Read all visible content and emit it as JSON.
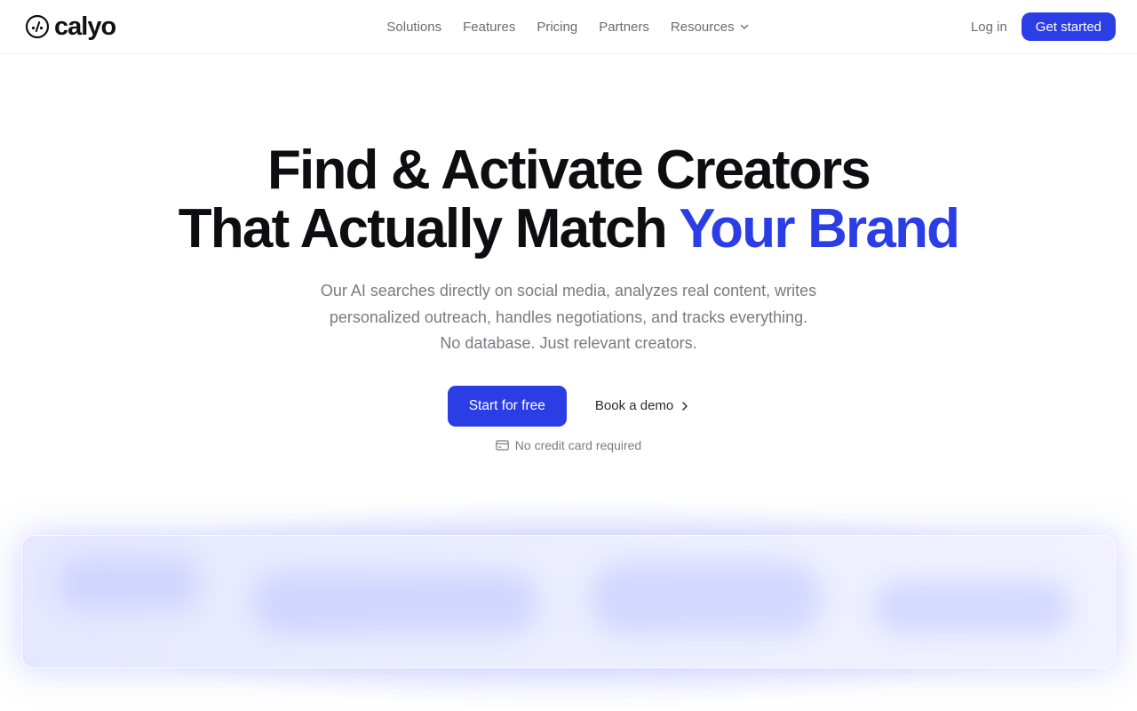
{
  "brand": {
    "name": "calyo"
  },
  "nav": {
    "items": [
      {
        "label": "Solutions"
      },
      {
        "label": "Features"
      },
      {
        "label": "Pricing"
      },
      {
        "label": "Partners"
      },
      {
        "label": "Resources",
        "has_dropdown": true
      }
    ]
  },
  "header": {
    "login_label": "Log in",
    "cta_label": "Get started"
  },
  "hero": {
    "headline_line1": "Find & Activate Creators",
    "headline_line2_prefix": "That Actually Match",
    "headline_line2_accent": "Your Brand",
    "subtext_line1": "Our AI searches directly on social media, analyzes real content, writes",
    "subtext_line2": "personalized outreach, handles negotiations, and tracks everything.",
    "subtext_line3": "No database. Just relevant creators.",
    "primary_cta": "Start for free",
    "secondary_cta": "Book a demo",
    "note": "No credit card required"
  },
  "icons": {
    "logo": "calyo-logo-icon",
    "resources_caret": "chevron-down-icon",
    "demo_arrow": "chevron-right-icon",
    "note_icon": "credit-card-icon"
  },
  "colors": {
    "accent": "#2b3ee6",
    "text_primary": "#0e0e12",
    "text_muted": "#7a7a84"
  }
}
